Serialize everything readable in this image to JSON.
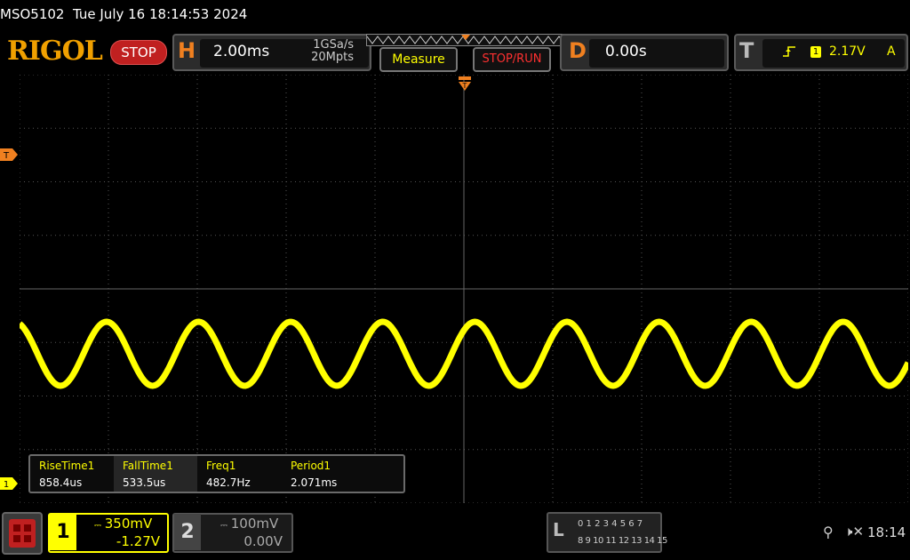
{
  "title_bar": {
    "model": "MSO5102",
    "datetime": "Tue July 16 18:14:53 2024"
  },
  "toolbar": {
    "logo": "RIGOL",
    "run_state": "STOP",
    "horizontal": {
      "letter": "H",
      "timebase": "2.00ms",
      "sample_rate": "1GSa/s",
      "memory_depth": "20Mpts"
    },
    "measure_label": "Measure",
    "stop_run_label": "STOP/RUN",
    "delay": {
      "letter": "D",
      "value": "0.00s"
    },
    "trigger": {
      "letter": "T",
      "source": "1",
      "level": "2.17V",
      "mode": "A"
    }
  },
  "markers": {
    "trigger_level": "T",
    "channel1": "1"
  },
  "measurements": [
    {
      "name": "RiseTime1",
      "value": "858.4us"
    },
    {
      "name": "FallTime1",
      "value": "533.5us"
    },
    {
      "name": "Freq1",
      "value": "482.7Hz"
    },
    {
      "name": "Period1",
      "value": "2.071ms"
    }
  ],
  "channels": [
    {
      "number": "1",
      "scale": "350mV",
      "offset": "-1.27V",
      "color": "#ffff00",
      "active": true
    },
    {
      "number": "2",
      "scale": "100mV",
      "offset": "0.00V",
      "color": "#aaaaaa",
      "active": false
    }
  ],
  "logic_analyzer": {
    "letter": "L",
    "row1": "0 1 2 3  4 5 6 7",
    "row2": "8 9 10 11 12 13 14 15"
  },
  "status": {
    "clock": "18:14"
  },
  "waveform": {
    "color": "#ffff00",
    "cycles_on_screen": 9.65
  }
}
